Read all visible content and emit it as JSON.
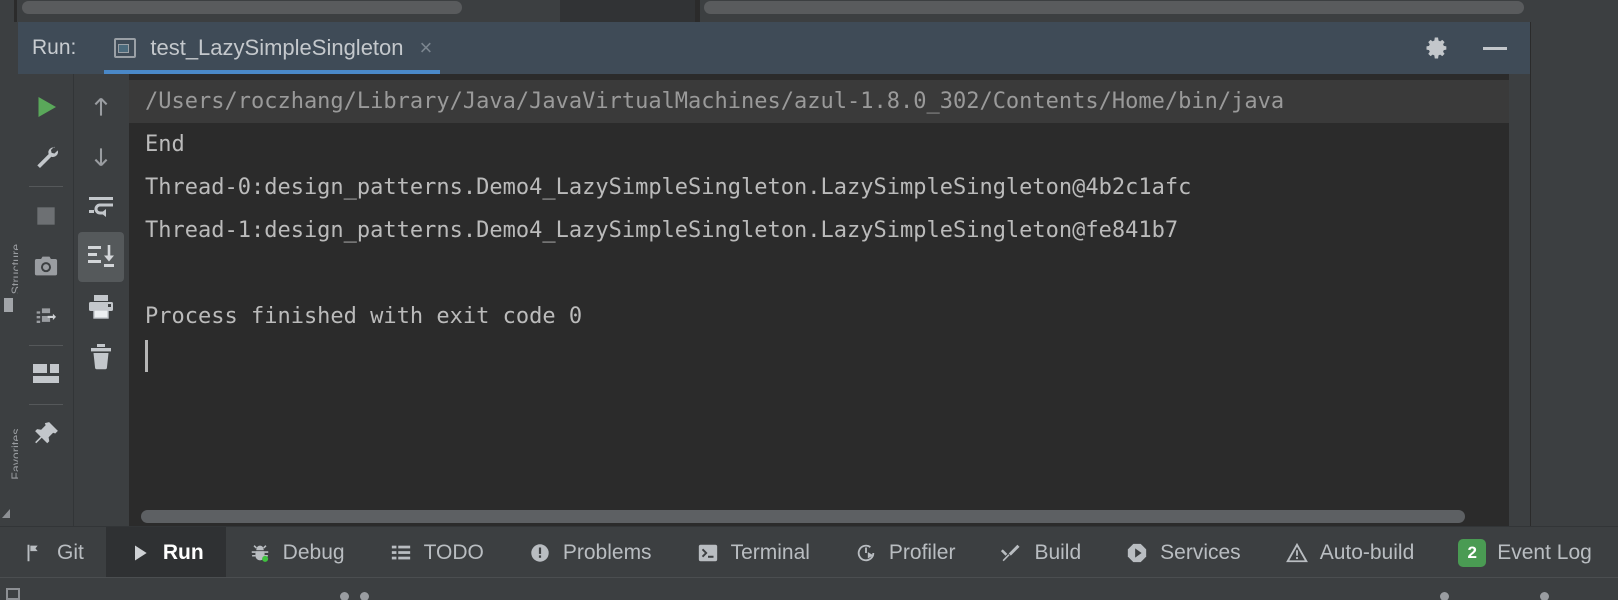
{
  "window": {
    "tool_window_label": "Run:",
    "tab_title": "test_LazySimpleSingleton",
    "tab_icon": "run-configuration-icon",
    "close_label": "×",
    "settings_icon": "gear-icon",
    "minimize_icon": "minimize-icon",
    "accent_color": "#4a88c7",
    "header_bg": "#3f4b57",
    "console_bg": "#2b2b2b",
    "panel_bg": "#3c3f41"
  },
  "left_stripe": {
    "labels": [
      {
        "name": "structure",
        "text": "Structure"
      },
      {
        "name": "favorites",
        "text": "Favorites"
      }
    ]
  },
  "toolbar_primary": [
    {
      "name": "rerun-button",
      "icon": "play-icon",
      "title": "Rerun",
      "active": false
    },
    {
      "name": "edit-configuration",
      "icon": "wrench-icon",
      "title": "Edit Configuration",
      "active": false
    },
    {
      "name": "separator-1",
      "icon": "separator",
      "title": "",
      "active": false
    },
    {
      "name": "stop-button",
      "icon": "stop-icon",
      "title": "Stop",
      "active": false
    },
    {
      "name": "screenshot-button",
      "icon": "camera-icon",
      "title": "Screenshot",
      "active": false
    },
    {
      "name": "dump-threads-button",
      "icon": "thread-dump-icon",
      "title": "Thread Dump",
      "active": false
    },
    {
      "name": "separator-2",
      "icon": "separator",
      "title": "",
      "active": false
    },
    {
      "name": "layout-button",
      "icon": "layout-icon",
      "title": "Layout",
      "active": false
    },
    {
      "name": "separator-3",
      "icon": "separator",
      "title": "",
      "active": false
    },
    {
      "name": "pin-tab-button",
      "icon": "pin-icon",
      "title": "Pin Tab",
      "active": false
    }
  ],
  "toolbar_secondary": [
    {
      "name": "prev-occurrence-button",
      "icon": "arrow-up-icon",
      "title": "Up the Stack Trace",
      "active": false
    },
    {
      "name": "next-occurrence-button",
      "icon": "arrow-down-icon",
      "title": "Down the Stack Trace",
      "active": false
    },
    {
      "name": "soft-wrap-button",
      "icon": "soft-wrap-icon",
      "title": "Soft-Wrap",
      "active": false
    },
    {
      "name": "scroll-to-end-button",
      "icon": "scroll-to-end-icon",
      "title": "Scroll to End",
      "active": true
    },
    {
      "name": "print-button",
      "icon": "printer-icon",
      "title": "Print",
      "active": false
    },
    {
      "name": "clear-all-button",
      "icon": "trash-icon",
      "title": "Clear All",
      "active": false
    }
  ],
  "console": {
    "lines": [
      {
        "name": "console-line-command",
        "kind": "cmdline",
        "text": "/Users/roczhang/Library/Java/JavaVirtualMachines/azul-1.8.0_302/Contents/Home/bin/java",
        "highlighted": true
      },
      {
        "name": "console-line-output",
        "kind": "out",
        "text": "End",
        "highlighted": false
      },
      {
        "name": "console-line-output",
        "kind": "out",
        "text": "Thread-0:design_patterns.Demo4_LazySimpleSingleton.LazySimpleSingleton@4b2c1afc",
        "highlighted": false
      },
      {
        "name": "console-line-output",
        "kind": "out",
        "text": "Thread-1:design_patterns.Demo4_LazySimpleSingleton.LazySimpleSingleton@fe841b7",
        "highlighted": false
      },
      {
        "name": "console-line-blank",
        "kind": "out",
        "text": " ",
        "highlighted": false
      },
      {
        "name": "console-line-exit",
        "kind": "sys",
        "text": "Process finished with exit code 0",
        "highlighted": false
      }
    ],
    "caret_visible": true,
    "hscrollbar": "horizontal-scrollbar"
  },
  "bottom_bar": {
    "items": [
      {
        "name": "bottom-tab-git",
        "label": "Git",
        "icon": "git-branch-icon",
        "selected": false,
        "badge": ""
      },
      {
        "name": "bottom-tab-run",
        "label": "Run",
        "icon": "play-icon",
        "selected": true,
        "badge": ""
      },
      {
        "name": "bottom-tab-debug",
        "label": "Debug",
        "icon": "bug-icon",
        "selected": false,
        "badge": ""
      },
      {
        "name": "bottom-tab-todo",
        "label": "TODO",
        "icon": "list-icon",
        "selected": false,
        "badge": ""
      },
      {
        "name": "bottom-tab-problems",
        "label": "Problems",
        "icon": "exclamation-icon",
        "selected": false,
        "badge": ""
      },
      {
        "name": "bottom-tab-terminal",
        "label": "Terminal",
        "icon": "terminal-icon",
        "selected": false,
        "badge": ""
      },
      {
        "name": "bottom-tab-profiler",
        "label": "Profiler",
        "icon": "profiler-icon",
        "selected": false,
        "badge": ""
      },
      {
        "name": "bottom-tab-build",
        "label": "Build",
        "icon": "hammer-icon",
        "selected": false,
        "badge": ""
      },
      {
        "name": "bottom-tab-services",
        "label": "Services",
        "icon": "services-icon",
        "selected": false,
        "badge": ""
      },
      {
        "name": "bottom-tab-auto-build",
        "label": "Auto-build",
        "icon": "warning-icon",
        "selected": false,
        "badge": ""
      },
      {
        "name": "bottom-tab-event-log",
        "label": "Event Log",
        "icon": "count-badge",
        "selected": false,
        "badge": "2"
      }
    ],
    "badge_color": "#4a9b53"
  }
}
